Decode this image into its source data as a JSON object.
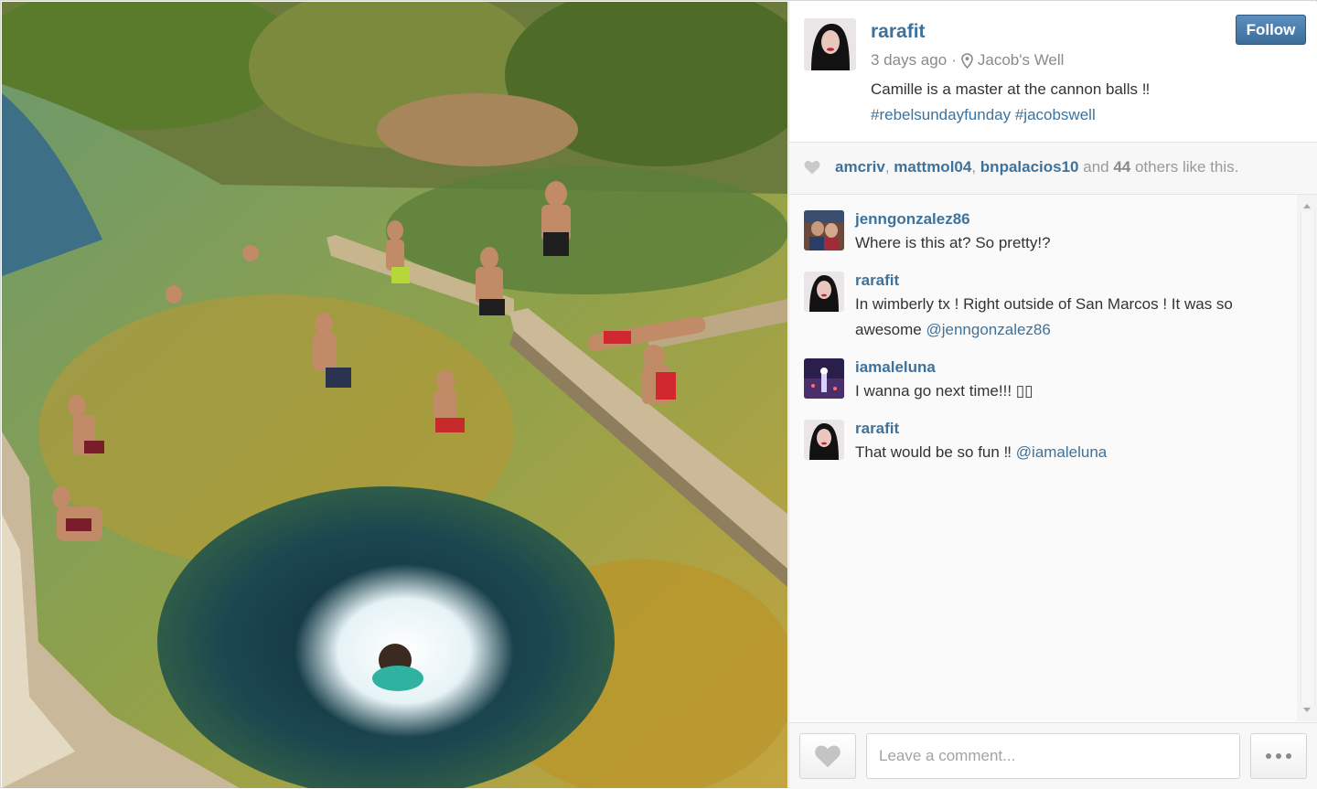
{
  "post": {
    "username": "rarafit",
    "time": "3 days ago",
    "separator": "·",
    "location": "Jacob's Well",
    "caption": "Camille is a master at the cannon balls ‼",
    "hashtags": "#rebelsundayfunday #jacobswell",
    "follow_label": "Follow"
  },
  "likes": {
    "users": [
      "amcriv",
      "mattmol04",
      "bnpalacios10"
    ],
    "comma": ",",
    "and": " and ",
    "count": "44",
    "suffix": " others like this."
  },
  "comments": [
    {
      "user": "jenngonzalez86",
      "text": "Where is this at? So pretty!?",
      "mention": ""
    },
    {
      "user": "rarafit",
      "text": "In wimberly tx ! Right outside of San Marcos ! It was so awesome ",
      "mention": "@jenngonzalez86"
    },
    {
      "user": "iamaleluna",
      "text": "I wanna go next time!!! ▯▯",
      "mention": ""
    },
    {
      "user": "rarafit",
      "text": "That would be so fun ‼ ",
      "mention": "@iamaleluna"
    }
  ],
  "footer": {
    "comment_placeholder": "Leave a comment..."
  },
  "colors": {
    "link": "#3f729b",
    "follow_button": "#4a7daf"
  },
  "icons": {
    "location": "pin-icon",
    "likes": "heart-icon",
    "like_button": "heart-icon",
    "more": "more-dots-icon"
  }
}
